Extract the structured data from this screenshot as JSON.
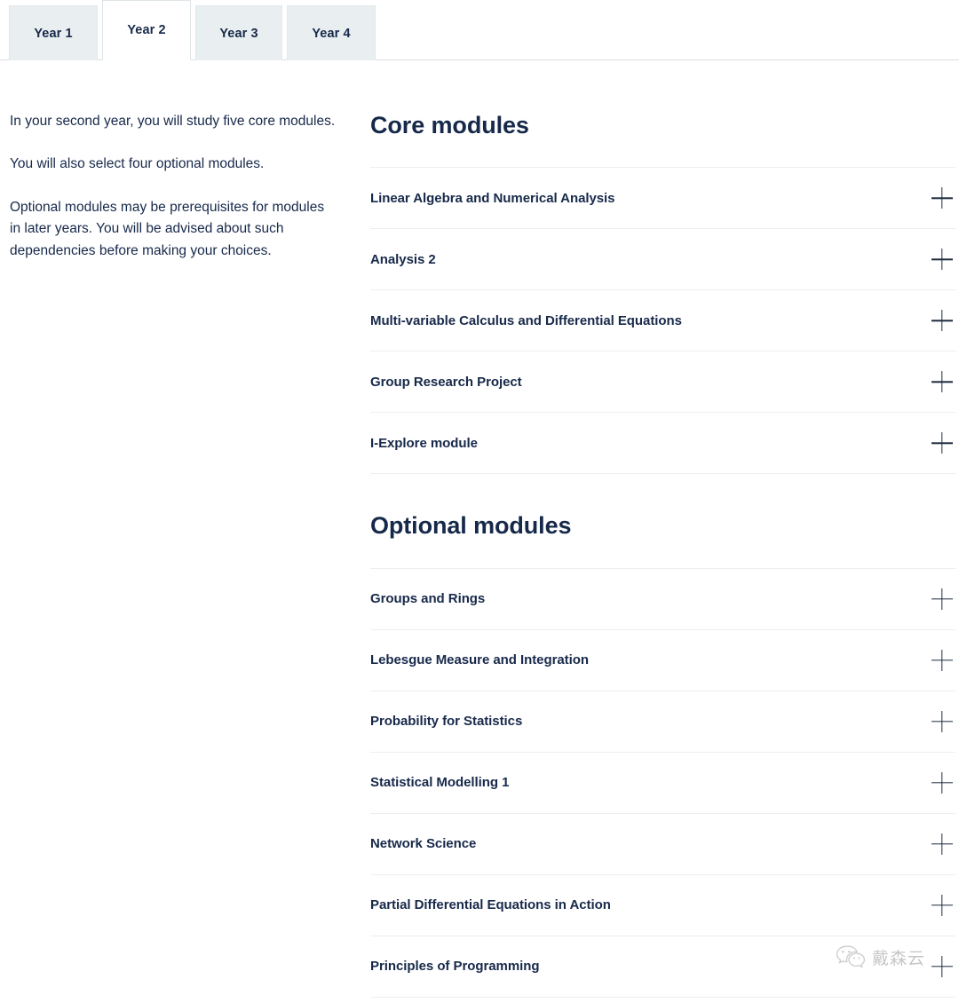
{
  "tabs": [
    {
      "label": "Year 1",
      "active": false
    },
    {
      "label": "Year 2",
      "active": true
    },
    {
      "label": "Year 3",
      "active": false
    },
    {
      "label": "Year 4",
      "active": false
    }
  ],
  "intro": {
    "paragraph_1": "In your second year, you will study five core modules.",
    "paragraph_2": "You will also select four optional modules.",
    "paragraph_3": "Optional modules may be prerequisites for modules in later years. You will be advised about such dependencies before making your choices."
  },
  "sections": [
    {
      "heading": "Core modules",
      "modules": [
        "Linear Algebra and Numerical Analysis",
        "Analysis 2",
        "Multi-variable Calculus and Differential Equations",
        "Group Research Project",
        "I-Explore module"
      ]
    },
    {
      "heading": "Optional modules",
      "modules": [
        "Groups and Rings",
        "Lebesgue Measure and Integration",
        "Probability for Statistics",
        "Statistical Modelling 1",
        "Network Science",
        "Partial Differential Equations in Action",
        "Principles of Programming"
      ]
    }
  ],
  "icons": {
    "expand": "plus-icon"
  },
  "watermark": {
    "text": "戴森云",
    "logo": "wechat-icon"
  },
  "colors": {
    "text_navy": "#17294a",
    "tab_inactive_bg": "#e9eef0",
    "tab_active_bg": "#ffffff",
    "divider": "#eceef0",
    "page_bg": "#ffffff"
  }
}
